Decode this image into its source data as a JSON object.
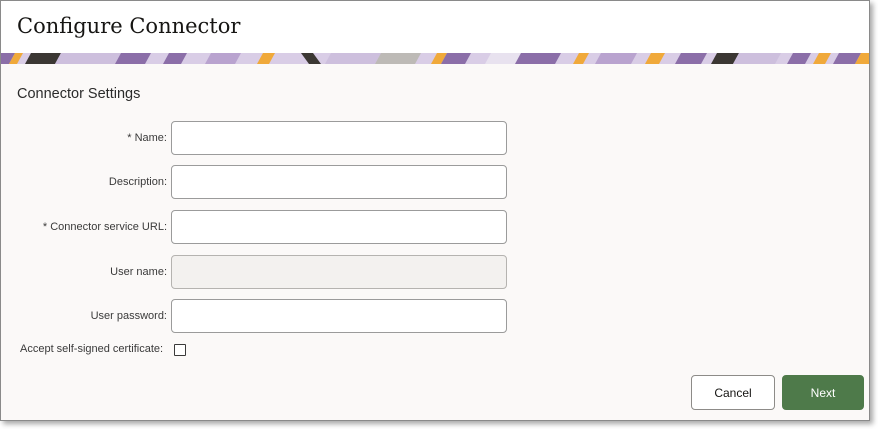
{
  "dialog": {
    "title": "Configure Connector",
    "section_title": "Connector Settings"
  },
  "form": {
    "fields": [
      {
        "label": "* Name:",
        "value": "",
        "disabled": false
      },
      {
        "label": "Description:",
        "value": "",
        "disabled": false
      },
      {
        "label": "* Connector service URL:",
        "value": "",
        "disabled": false
      },
      {
        "label": "User name:",
        "value": "",
        "disabled": true
      },
      {
        "label": "User password:",
        "value": "",
        "disabled": false
      }
    ],
    "self_signed": {
      "label": "Accept self-signed certificate:",
      "checked": false
    }
  },
  "footer": {
    "cancel_label": "Cancel",
    "next_label": "Next"
  },
  "colors": {
    "accent_green": "#4e7a4a",
    "banner_purple": "#8b6ea8",
    "banner_orange": "#f0a93a",
    "banner_dark": "#3b3733"
  },
  "icons": {
    "banner": "decorative-pattern"
  }
}
